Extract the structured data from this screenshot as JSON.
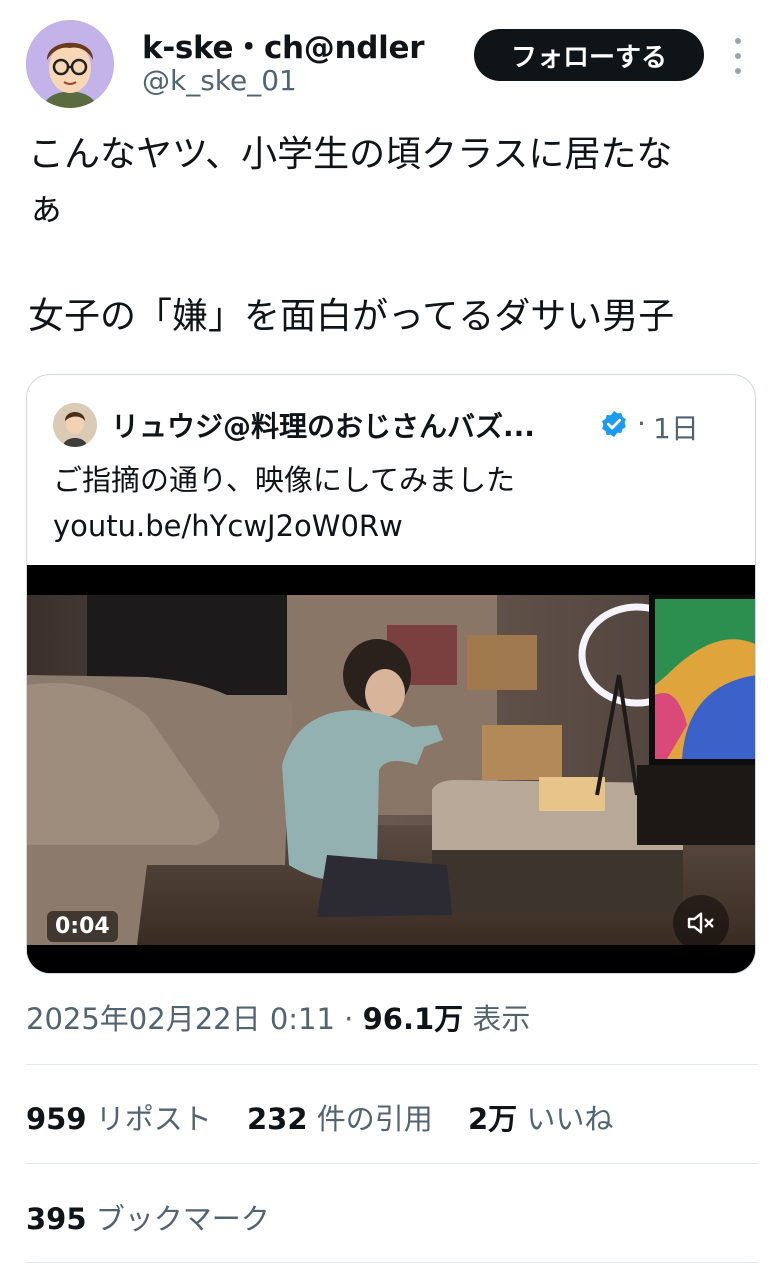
{
  "author": {
    "display_name": "k-ske・ch@ndler",
    "handle": "@k_ske_01",
    "avatar_icon": "cartoon-avatar-icon"
  },
  "follow_label": "フォローする",
  "tweet": {
    "text": "こんなヤツ、小学生の頃クラスに居たな\nぁ\n\n女子の「嫌」を面白がってるダサい男子"
  },
  "quote": {
    "display_name": "リュウジ@料理のおじさんバズ...",
    "verified_icon": "verified-badge-icon",
    "separator": "·",
    "time": "1日",
    "text": "ご指摘の通り、映像にしてみました\nyoutu.be/hYcwJ2oW0Rw",
    "video": {
      "duration": "0:04",
      "mute_icon": "speaker-muted-icon"
    }
  },
  "meta": {
    "datetime": "2025年02月22日 0:11",
    "separator": "·",
    "views_count": "96.1万",
    "views_label": "表示"
  },
  "stats": {
    "reposts_count": "959",
    "reposts_label": "リポスト",
    "quotes_count": "232",
    "quotes_label": "件の引用",
    "likes_count": "2万",
    "likes_label": "いいね",
    "bookmarks_count": "395",
    "bookmarks_label": "ブックマーク"
  },
  "colors": {
    "text": "#0f1419",
    "secondary": "#536471",
    "verified": "#1d9bf0",
    "border": "#cfd9de"
  }
}
